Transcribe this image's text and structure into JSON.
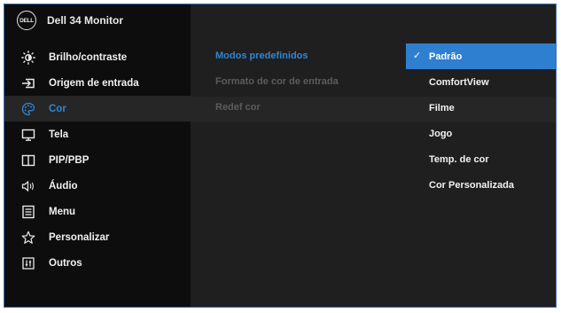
{
  "header": {
    "logo_text": "DELL",
    "model": "Dell  34 Monitor"
  },
  "menu": [
    {
      "label": "Brilho/contraste",
      "icon": "brightness-icon"
    },
    {
      "label": "Origem de entrada",
      "icon": "input-source-icon"
    },
    {
      "label": "Cor",
      "icon": "color-palette-icon",
      "selected": true
    },
    {
      "label": "Tela",
      "icon": "display-icon"
    },
    {
      "label": "PIP/PBP",
      "icon": "pip-pbp-icon"
    },
    {
      "label": "Áudio",
      "icon": "audio-icon"
    },
    {
      "label": "Menu",
      "icon": "menu-icon"
    },
    {
      "label": "Personalizar",
      "icon": "star-icon"
    },
    {
      "label": "Outros",
      "icon": "others-icon"
    }
  ],
  "submenu": {
    "items": [
      {
        "label": "Modos predefinidos",
        "state": "active"
      },
      {
        "label": "Formato de cor de entrada",
        "state": "disabled"
      },
      {
        "label": "Redef cor",
        "state": "disabled"
      }
    ]
  },
  "preset_modes": {
    "options": [
      {
        "label": "Padrão",
        "checked": true
      },
      {
        "label": "ComfortView"
      },
      {
        "label": "Filme"
      },
      {
        "label": "Jogo"
      },
      {
        "label": "Temp. de cor"
      },
      {
        "label": "Cor Personalizada"
      }
    ],
    "check_glyph": "✓"
  },
  "colors": {
    "accent": "#2f86d6",
    "selected_bg": "#2f7fd0",
    "panel_bg": "#1f1f1f",
    "sidebar_bg": "#0d0d0d"
  }
}
